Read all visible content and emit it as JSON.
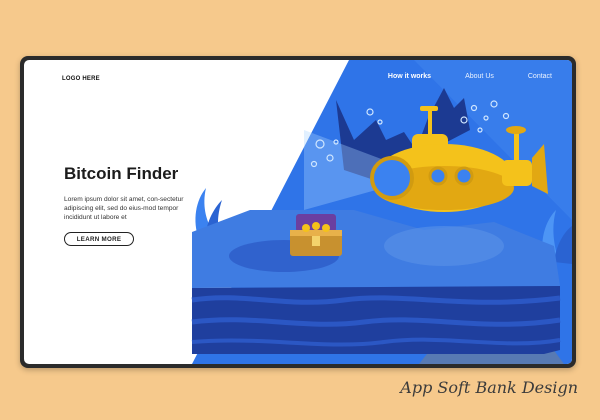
{
  "header": {
    "logo": "LOGO HERE",
    "nav": [
      {
        "label": "How it works",
        "active": true
      },
      {
        "label": "About Us",
        "active": false
      },
      {
        "label": "Contact",
        "active": false
      }
    ]
  },
  "hero": {
    "title": "Bitcoin Finder",
    "body": "Lorem ipsum dolor sit amet, con-sectetur adipiscing elit, sed do eius-mod tempor incididunt ut labore et",
    "cta_label": "LEARN MORE"
  },
  "illustration": {
    "subject": "submarine-finding-treasure-chest",
    "colors": {
      "sky": "#2f74e8",
      "sea_light": "#3c7be0",
      "sea_dark": "#1f3f9e",
      "submarine": "#f4c21b",
      "chest": "#c8912f"
    }
  },
  "watermark": "App Soft Bank Design"
}
